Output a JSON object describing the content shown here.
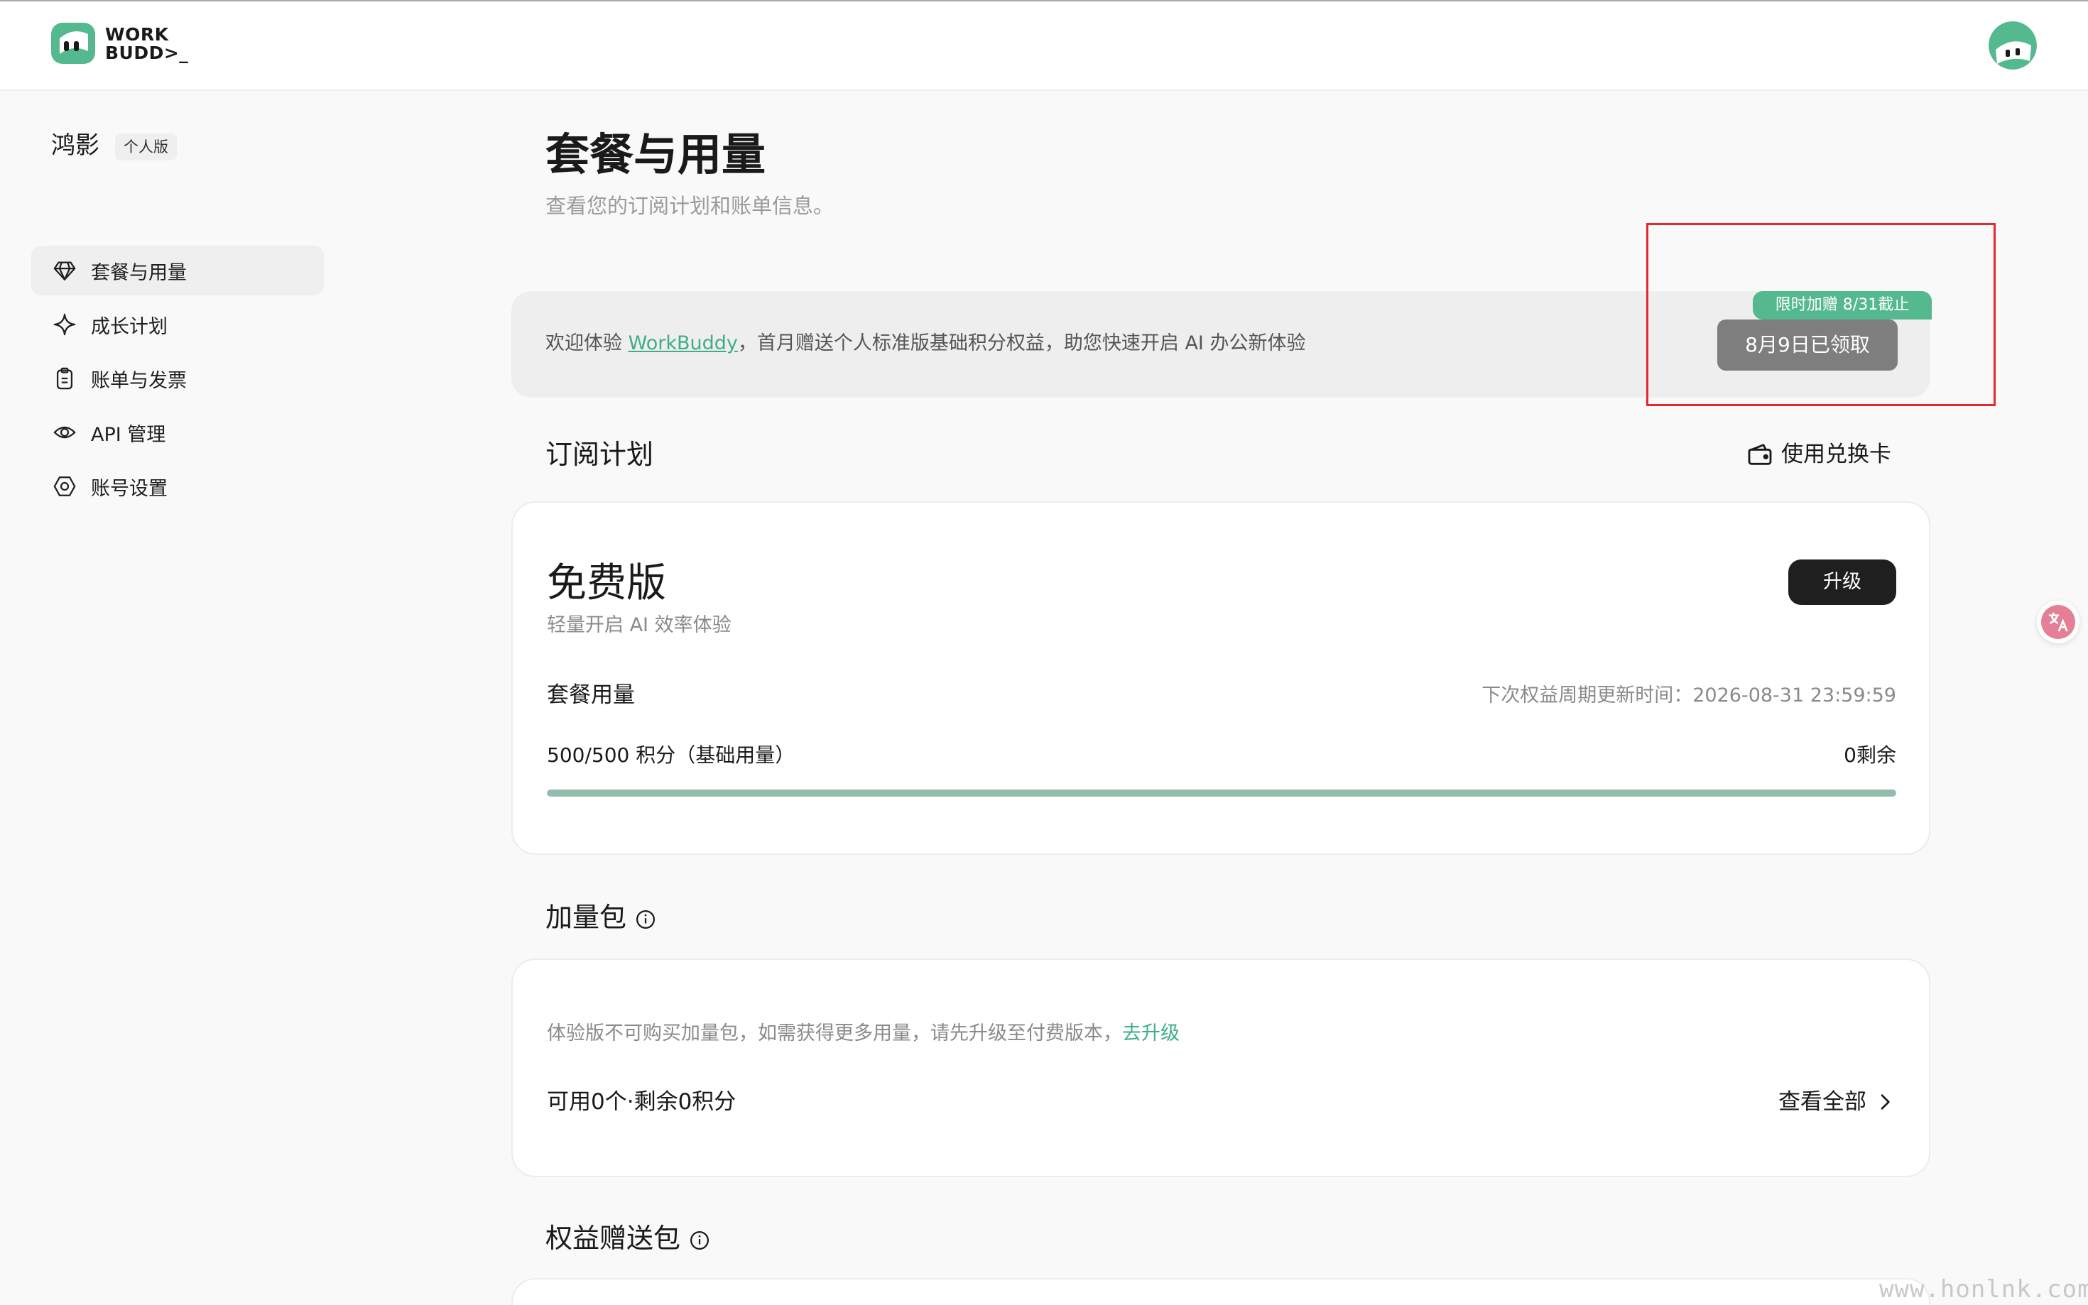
{
  "brand": {
    "line1": "WORK",
    "line2": "BUDD>_",
    "accent": "#55b98f"
  },
  "user": {
    "name": "鸿影",
    "edition": "个人版"
  },
  "sidebar": {
    "items": [
      {
        "label": "套餐与用量",
        "icon": "diamond-icon",
        "active": true
      },
      {
        "label": "成长计划",
        "icon": "sparkle-icon",
        "active": false
      },
      {
        "label": "账单与发票",
        "icon": "clipboard-icon",
        "active": false
      },
      {
        "label": "API 管理",
        "icon": "eye-icon",
        "active": false
      },
      {
        "label": "账号设置",
        "icon": "settings-icon",
        "active": false
      }
    ]
  },
  "page": {
    "title": "套餐与用量",
    "subtitle": "查看您的订阅计划和账单信息。"
  },
  "promo": {
    "text_before": "欢迎体验 ",
    "link": "WorkBuddy",
    "text_after": "，首月赠送个人标准版基础积分权益，助您快速开启 AI 办公新体验",
    "tag": "限时加赠 8/31截止",
    "claimed_label": "8月9日已领取"
  },
  "subscription": {
    "section_title": "订阅计划",
    "redeem_label": "使用兑换卡",
    "plan_name": "免费版",
    "plan_desc": "轻量开启 AI 效率体验",
    "upgrade_label": "升级",
    "usage_title": "套餐用量",
    "next_refresh": "下次权益周期更新时间：2026-08-31 23:59:59",
    "usage_amount": "500/500 积分（基础用量）",
    "remaining": "0剩余",
    "usage_fraction": 1.0
  },
  "addon": {
    "section_title": "加量包",
    "note": "体验版不可购买加量包，如需获得更多用量，请先升级至付费版本，",
    "note_link": "去升级",
    "available": "可用0个·剩余0积分",
    "view_all": "查看全部"
  },
  "gift": {
    "section_title": "权益赠送包"
  },
  "watermark": "www.honlnk.com"
}
